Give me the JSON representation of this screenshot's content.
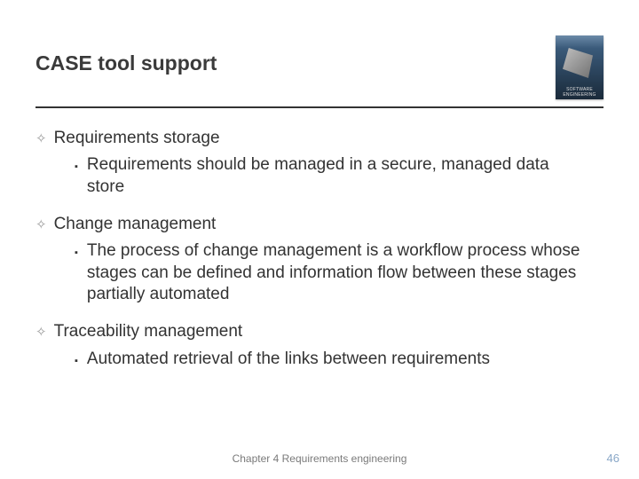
{
  "title": "CASE tool support",
  "book_label": "SOFTWARE ENGINEERING",
  "sections": [
    {
      "heading": "Requirements storage",
      "items": [
        "Requirements should be managed in a secure, managed data store"
      ]
    },
    {
      "heading": "Change management",
      "items": [
        "The process of change management is a workflow process whose stages can be defined and information flow between these stages partially automated"
      ]
    },
    {
      "heading": "Traceability management",
      "items": [
        "Automated retrieval of the links between requirements"
      ]
    }
  ],
  "footer_chapter": "Chapter 4 Requirements engineering",
  "page_number": "46"
}
